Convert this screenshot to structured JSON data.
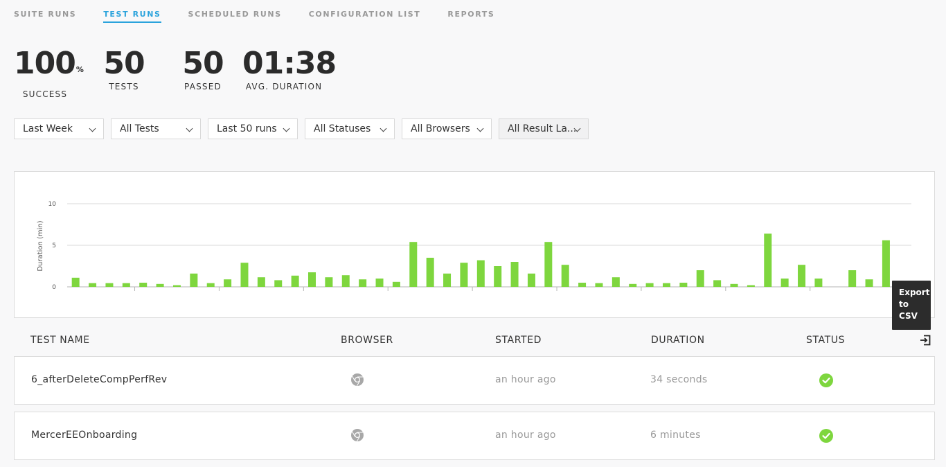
{
  "tabs": [
    {
      "label": "SUITE RUNS",
      "active": false
    },
    {
      "label": "TEST RUNS",
      "active": true
    },
    {
      "label": "SCHEDULED RUNS",
      "active": false
    },
    {
      "label": "CONFIGURATION LIST",
      "active": false
    },
    {
      "label": "REPORTS",
      "active": false
    }
  ],
  "stats": {
    "success": {
      "value": "100",
      "unit": "%",
      "label": "SUCCESS"
    },
    "tests": {
      "value": "50",
      "label": "TESTS"
    },
    "passed": {
      "value": "50",
      "label": "PASSED"
    },
    "duration": {
      "value": "01:38",
      "label": "AVG. DURATION"
    }
  },
  "filters": {
    "period": "Last Week",
    "tests": "All Tests",
    "runs": "Last 50 runs",
    "statuses": "All Statuses",
    "browsers": "All Browsers",
    "labels": "All Result La..."
  },
  "tooltip": {
    "line1": "Export",
    "line2": "to",
    "line3": "CSV"
  },
  "table": {
    "headers": {
      "name": "TEST NAME",
      "browser": "BROWSER",
      "started": "STARTED",
      "duration": "DURATION",
      "status": "STATUS"
    },
    "rows": [
      {
        "name": "6_afterDeleteCompPerfRev",
        "browser": "chrome-icon",
        "started": "an hour ago",
        "duration": "34 seconds",
        "status": "passed"
      },
      {
        "name": "MercerEEOnboarding",
        "browser": "chrome-icon",
        "started": "an hour ago",
        "duration": "6 minutes",
        "status": "passed"
      }
    ]
  },
  "colors": {
    "accent": "#2ba3dc",
    "bar": "#7ed63e",
    "success": "#7ed63e"
  },
  "chart_data": {
    "type": "bar",
    "ylabel": "Duration (min)",
    "ylim": [
      0,
      10
    ],
    "yticks": [
      0,
      5,
      10
    ],
    "grid": true,
    "values": [
      1.1,
      0.45,
      0.45,
      0.45,
      0.5,
      0.35,
      0.2,
      1.6,
      0.45,
      0.9,
      2.9,
      1.15,
      0.8,
      1.35,
      1.75,
      1.15,
      1.4,
      0.9,
      1.0,
      0.6,
      5.4,
      3.5,
      1.6,
      2.9,
      3.2,
      2.5,
      3.0,
      1.6,
      5.4,
      2.65,
      0.5,
      0.45,
      1.15,
      0.35,
      0.45,
      0.45,
      0.5,
      2.0,
      0.8,
      0.35,
      0.2,
      6.4,
      1.0,
      2.65,
      1.0,
      0.0,
      2.0,
      0.9,
      5.6,
      0.6
    ]
  }
}
